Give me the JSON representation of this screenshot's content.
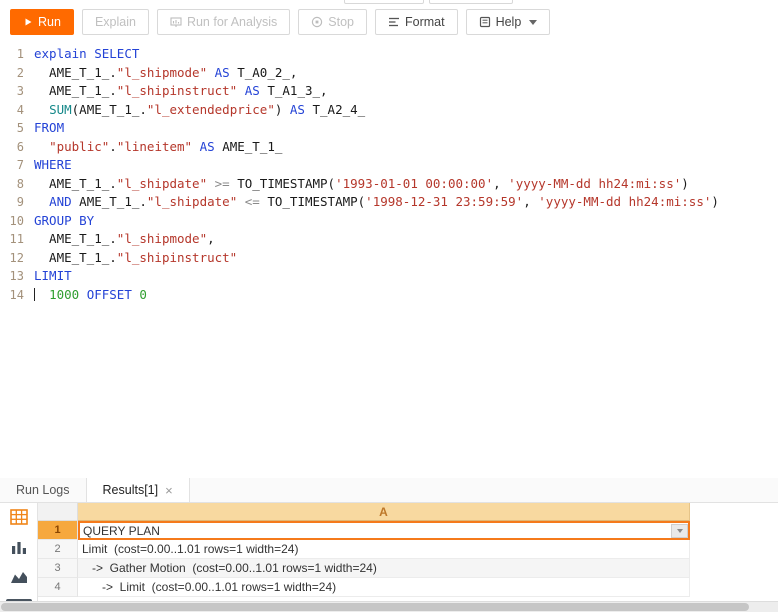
{
  "colors": {
    "accent": "#ff6a00",
    "selection_border": "#f57a1b",
    "selected_row_header": "#f6a83e",
    "column_header_bg": "#f8d9a0",
    "keyword": "#2443d6",
    "string": "#b5372b",
    "number": "#2f9e2f",
    "function": "#16898a",
    "operator": "#8a8a8a"
  },
  "toolbar": {
    "run_label": "Run",
    "explain_label": "Explain",
    "analysis_label": "Run for Analysis",
    "stop_label": "Stop",
    "format_label": "Format",
    "help_label": "Help"
  },
  "editor": {
    "lines": [
      {
        "num": "1",
        "segs": [
          [
            "explain",
            "kw"
          ],
          [
            " ",
            "pl"
          ],
          [
            "SELECT",
            "kw"
          ]
        ]
      },
      {
        "num": "2",
        "segs": [
          [
            "  AME_T_1_.",
            "pl"
          ],
          [
            "\"l_shipmode\"",
            "str"
          ],
          [
            " ",
            "pl"
          ],
          [
            "AS",
            "kw"
          ],
          [
            " T_A0_2_,",
            "pl"
          ]
        ]
      },
      {
        "num": "3",
        "segs": [
          [
            "  AME_T_1_.",
            "pl"
          ],
          [
            "\"l_shipinstruct\"",
            "str"
          ],
          [
            " ",
            "pl"
          ],
          [
            "AS",
            "kw"
          ],
          [
            " T_A1_3_,",
            "pl"
          ]
        ]
      },
      {
        "num": "4",
        "segs": [
          [
            "  ",
            "pl"
          ],
          [
            "SUM",
            "fn"
          ],
          [
            "(AME_T_1_.",
            "pl"
          ],
          [
            "\"l_extendedprice\"",
            "str"
          ],
          [
            ") ",
            "pl"
          ],
          [
            "AS",
            "kw"
          ],
          [
            " T_A2_4_",
            "pl"
          ]
        ]
      },
      {
        "num": "5",
        "segs": [
          [
            "FROM",
            "kw"
          ]
        ]
      },
      {
        "num": "6",
        "segs": [
          [
            "  ",
            "pl"
          ],
          [
            "\"public\"",
            "str"
          ],
          [
            ".",
            "pl"
          ],
          [
            "\"lineitem\"",
            "str"
          ],
          [
            " ",
            "pl"
          ],
          [
            "AS",
            "kw"
          ],
          [
            " AME_T_1_",
            "pl"
          ]
        ]
      },
      {
        "num": "7",
        "segs": [
          [
            "WHERE",
            "kw"
          ]
        ]
      },
      {
        "num": "8",
        "segs": [
          [
            "  AME_T_1_.",
            "pl"
          ],
          [
            "\"l_shipdate\"",
            "str"
          ],
          [
            " ",
            "pl"
          ],
          [
            ">=",
            "op"
          ],
          [
            " TO_TIMESTAMP(",
            "pl"
          ],
          [
            "'1993-01-01 00:00:00'",
            "str"
          ],
          [
            ", ",
            "pl"
          ],
          [
            "'yyyy-MM-dd hh24:mi:ss'",
            "str"
          ],
          [
            ")",
            "pl"
          ]
        ]
      },
      {
        "num": "9",
        "segs": [
          [
            "  ",
            "pl"
          ],
          [
            "AND",
            "kw"
          ],
          [
            " AME_T_1_.",
            "pl"
          ],
          [
            "\"l_shipdate\"",
            "str"
          ],
          [
            " ",
            "pl"
          ],
          [
            "<=",
            "op"
          ],
          [
            " TO_TIMESTAMP(",
            "pl"
          ],
          [
            "'1998-12-31 23:59:59'",
            "str"
          ],
          [
            ", ",
            "pl"
          ],
          [
            "'yyyy-MM-dd hh24:mi:ss'",
            "str"
          ],
          [
            ")",
            "pl"
          ]
        ]
      },
      {
        "num": "10",
        "segs": [
          [
            "GROUP BY",
            "kw"
          ]
        ]
      },
      {
        "num": "11",
        "segs": [
          [
            "  AME_T_1_.",
            "pl"
          ],
          [
            "\"l_shipmode\"",
            "str"
          ],
          [
            ",",
            "pl"
          ]
        ]
      },
      {
        "num": "12",
        "segs": [
          [
            "  AME_T_1_.",
            "pl"
          ],
          [
            "\"l_shipinstruct\"",
            "str"
          ]
        ]
      },
      {
        "num": "13",
        "segs": [
          [
            "LIMIT",
            "kw"
          ]
        ]
      },
      {
        "num": "14",
        "cursor": true,
        "segs": [
          [
            "  ",
            "pl"
          ],
          [
            "1000",
            "num"
          ],
          [
            " ",
            "pl"
          ],
          [
            "OFFSET",
            "kw"
          ],
          [
            " ",
            "pl"
          ],
          [
            "0",
            "num"
          ]
        ]
      }
    ]
  },
  "results": {
    "tabs": [
      {
        "label": "Run Logs",
        "active": false,
        "closable": false
      },
      {
        "label": "Results[1]",
        "active": true,
        "closable": true
      }
    ],
    "column_header": "A",
    "rows": [
      {
        "num": "1",
        "text": "QUERY PLAN",
        "selected": true
      },
      {
        "num": "2",
        "text": "Limit  (cost=0.00..1.01 rows=1 width=24)"
      },
      {
        "num": "3",
        "text": "   ->  Gather Motion  (cost=0.00..1.01 rows=1 width=24)",
        "shaded": true
      },
      {
        "num": "4",
        "text": "      ->  Limit  (cost=0.00..1.01 rows=1 width=24)"
      }
    ],
    "view_icons": [
      "table-view",
      "bar-chart",
      "area-chart"
    ]
  },
  "icons": {
    "close_glyph": "×"
  }
}
